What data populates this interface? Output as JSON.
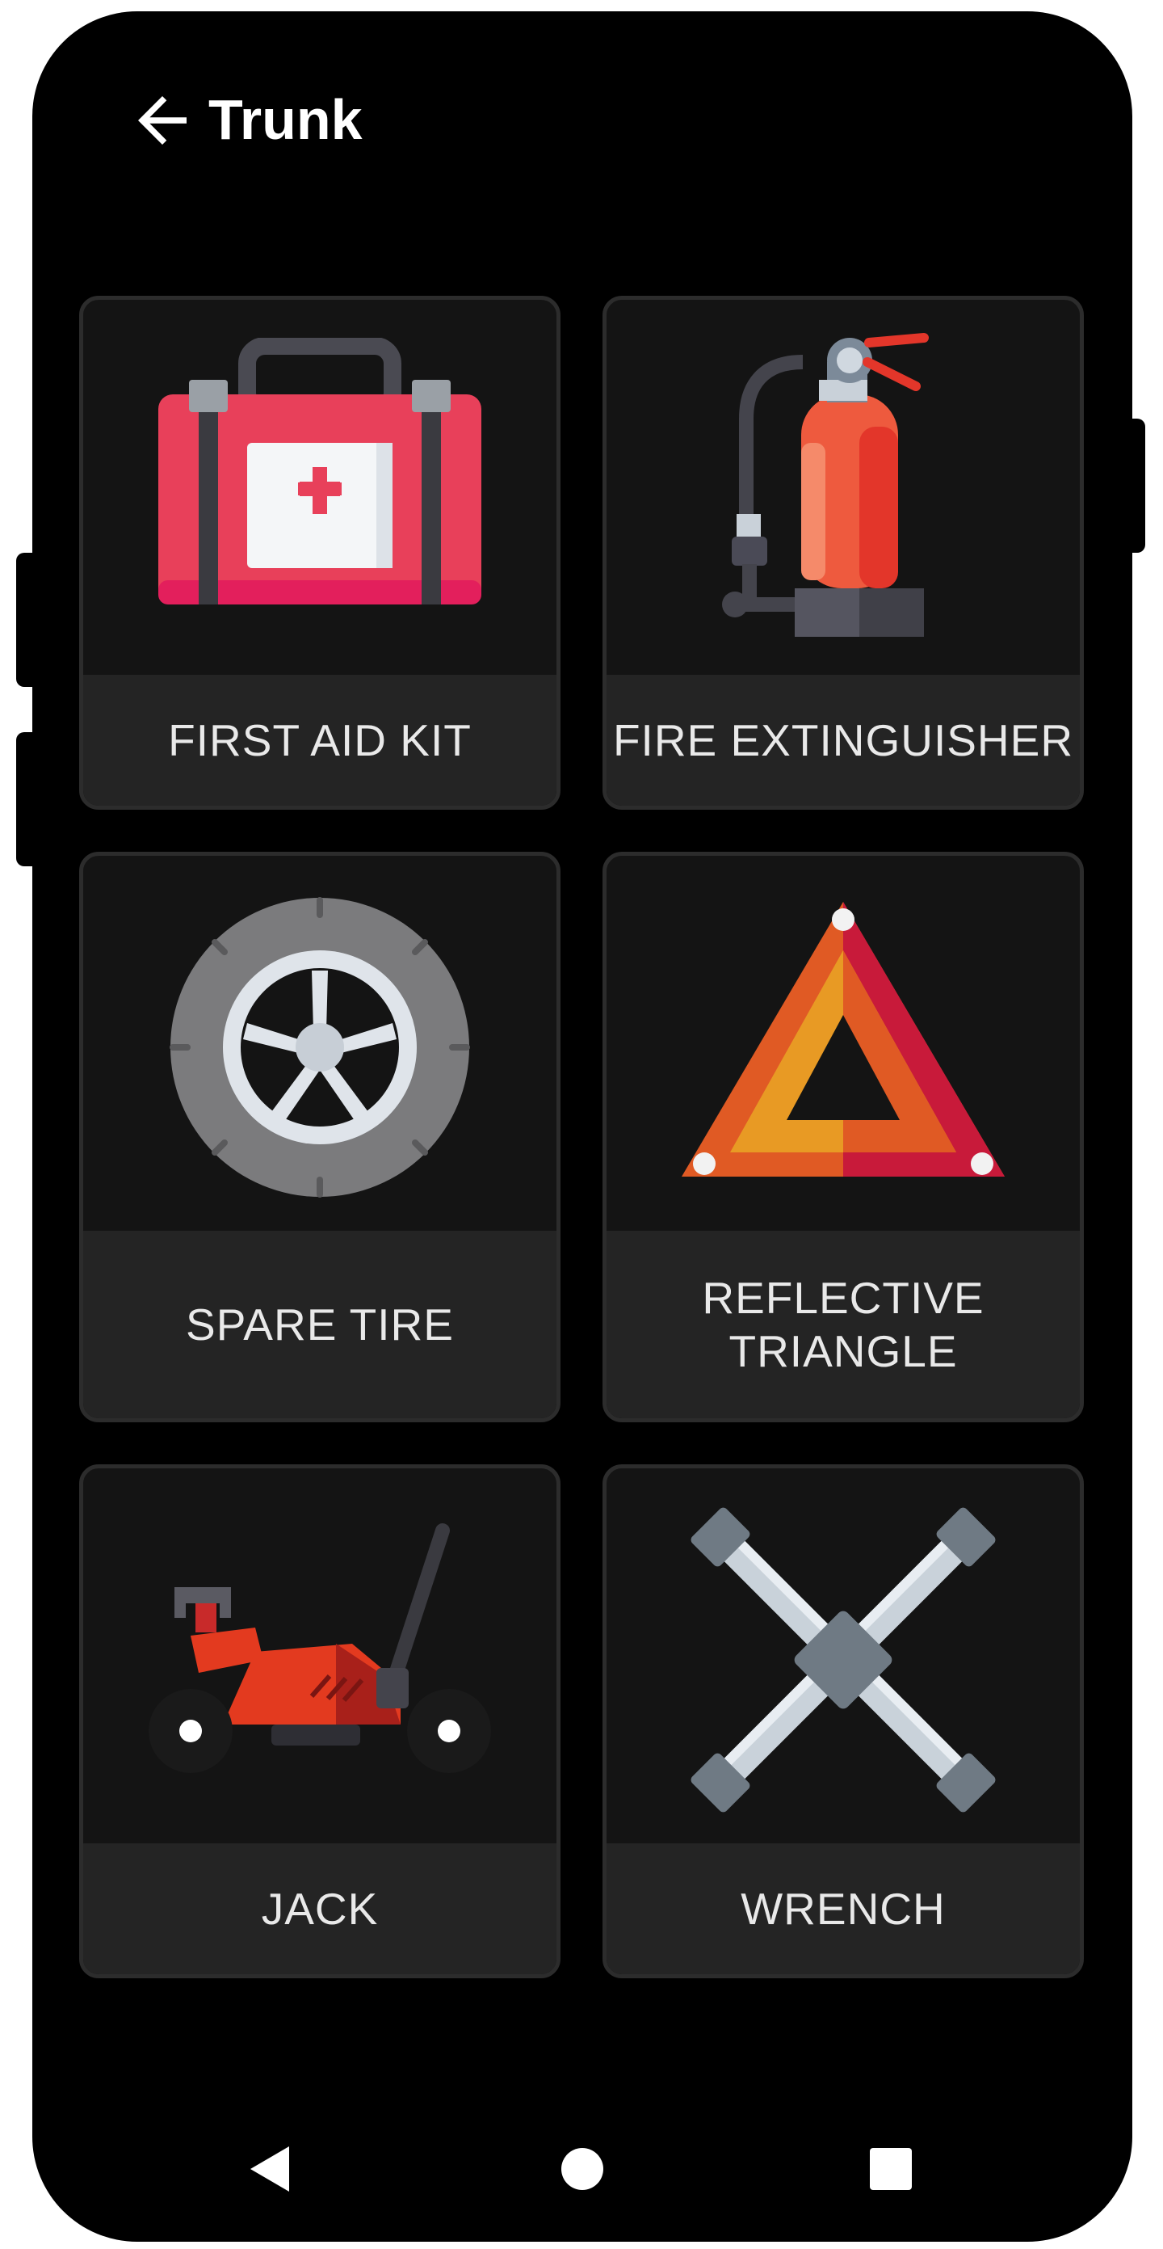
{
  "app_bar": {
    "title": "Trunk",
    "back_icon": "arrow-left-icon"
  },
  "items": [
    {
      "label": "FIRST AID KIT",
      "icon": "first-aid-kit-icon"
    },
    {
      "label": "FIRE EXTINGUISHER",
      "icon": "fire-extinguisher-icon"
    },
    {
      "label": "SPARE TIRE",
      "icon": "spare-tire-icon"
    },
    {
      "label": "REFLECTIVE\nTRIANGLE",
      "icon": "reflective-triangle-icon"
    },
    {
      "label": "JACK",
      "icon": "jack-icon"
    },
    {
      "label": "WRENCH",
      "icon": "wrench-icon"
    }
  ],
  "nav_bar": {
    "back_icon": "triangle-back-icon",
    "home_icon": "circle-home-icon",
    "recents_icon": "square-recents-icon"
  },
  "colors": {
    "background": "#000000",
    "card": "#141414",
    "card_label": "#242424",
    "card_border": "#2c2c2c",
    "text": "#e9e9e9"
  }
}
